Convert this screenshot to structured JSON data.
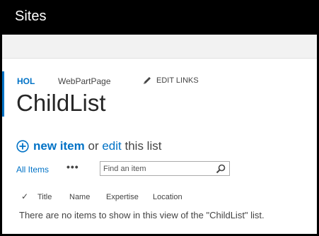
{
  "topbar": {
    "title": "Sites"
  },
  "nav": {
    "hol": "HOL",
    "webpartpage": "WebPartPage",
    "edit_links": "EDIT LINKS"
  },
  "page_title": "ChildList",
  "actions": {
    "new_item": "new item",
    "or": "or",
    "edit": "edit",
    "this_list": "this list"
  },
  "view": {
    "all_items": "All Items",
    "more": "•••"
  },
  "search": {
    "placeholder": "Find an item"
  },
  "columns": [
    "Title",
    "Name",
    "Expertise",
    "Location"
  ],
  "empty_message": "There are no items to show in this view of the \"ChildList\" list.",
  "colors": {
    "accent": "#0072c6",
    "topbar": "#000000"
  }
}
